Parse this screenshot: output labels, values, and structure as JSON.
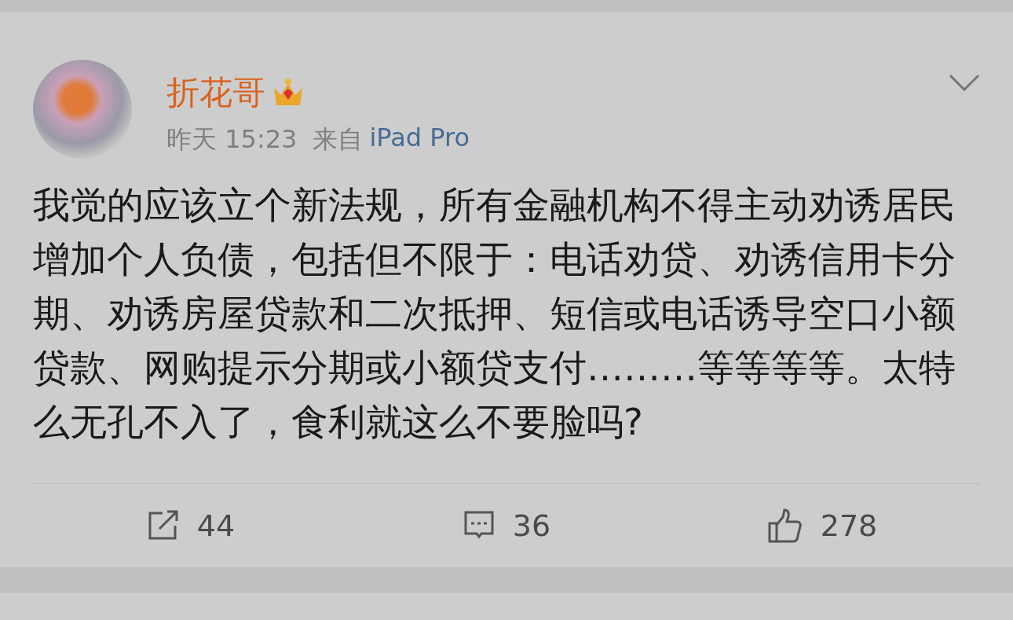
{
  "post": {
    "author": "折花哥",
    "time": "昨天 15:23",
    "source_prefix": "来自",
    "source": "iPad Pro",
    "text": "我觉的应该立个新法规，所有金融机构不得主动劝诱居民增加个人负债，包括但不限于：电话劝贷、劝诱信用卡分期、劝诱房屋贷款和二次抵押、短信或电话诱导空口小额贷款、网购提示分期或小额贷支付………等等等等。太特么无孔不入了，食利就这么不要脸吗?",
    "actions": [
      {
        "kind": "repost",
        "count": "44"
      },
      {
        "kind": "comment",
        "count": "36"
      },
      {
        "kind": "like",
        "count": "278"
      }
    ]
  }
}
